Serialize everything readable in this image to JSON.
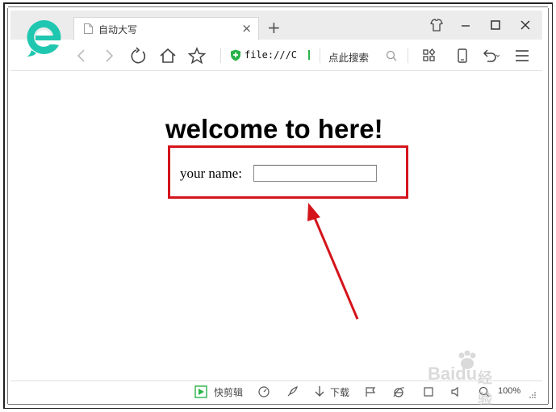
{
  "browser": {
    "tab_title": "自动大写",
    "address": "file:///C",
    "search_label": "点此搜索",
    "new_tab_symbol": "+",
    "tab_close_symbol": "×"
  },
  "page": {
    "heading": "welcome to here!",
    "name_label": "your name:",
    "name_value": ""
  },
  "statusbar": {
    "quick_cut": "快剪辑",
    "download": "下载",
    "zoom": "100%"
  },
  "watermark": {
    "text": "Baidu",
    "sub": "经验"
  },
  "colors": {
    "highlight": "#d4141b",
    "accent_green": "#2ab34a",
    "logo_teal": "#1fc7b0"
  }
}
